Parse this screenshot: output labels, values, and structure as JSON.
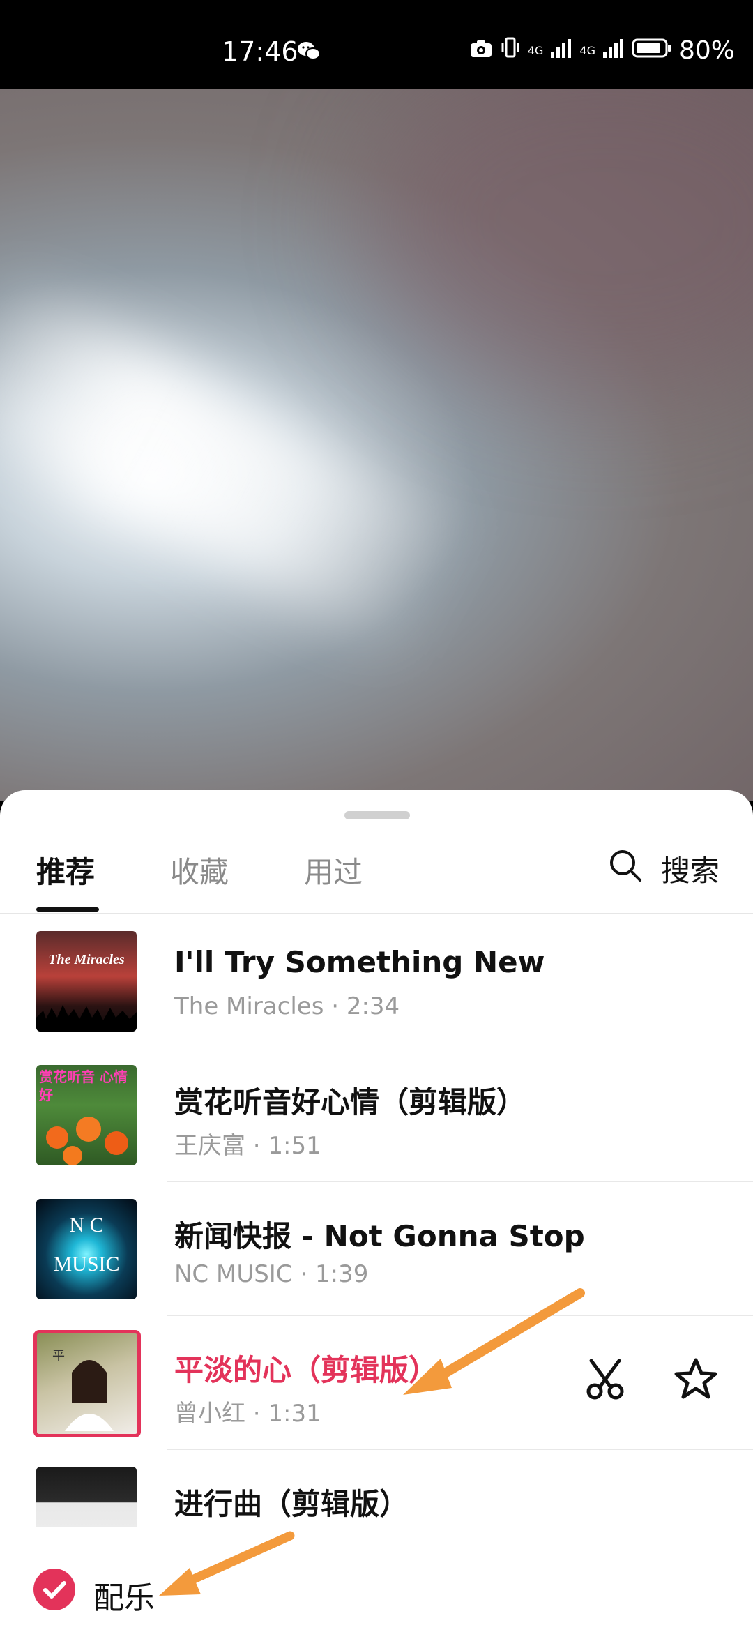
{
  "status": {
    "time": "17:46",
    "network1": "4G",
    "network2": "4G",
    "battery": "80%",
    "icons": [
      "wechat-icon",
      "camera-icon",
      "vibrate-icon",
      "signal-icon",
      "battery-icon"
    ]
  },
  "tabs": [
    {
      "label": "推荐",
      "active": true
    },
    {
      "label": "收藏",
      "active": false
    },
    {
      "label": "用过",
      "active": false
    }
  ],
  "search_label": "搜索",
  "songs": [
    {
      "title": "I'll Try Something New",
      "meta": "The Miracles · 2:34",
      "cover_text": "The Miracles"
    },
    {
      "title": "赏花听音好心情（剪辑版）",
      "meta": "王庆富 · 1:51",
      "cover_text": "赏花听音 心情好"
    },
    {
      "title": "新闻快报 - Not Gonna Stop",
      "meta": "NC MUSIC · 1:39",
      "cover_text": "N C MUSIC"
    },
    {
      "title": "平淡的心（剪辑版）",
      "meta": "曾小红 · 1:31",
      "cover_text": "平",
      "selected": true
    },
    {
      "title": "进行曲（剪辑版）",
      "meta": ""
    }
  ],
  "bottom": {
    "label": "配乐",
    "checked": true
  },
  "colors": {
    "accent": "#e3335a",
    "arrow": "#f39a3c"
  }
}
